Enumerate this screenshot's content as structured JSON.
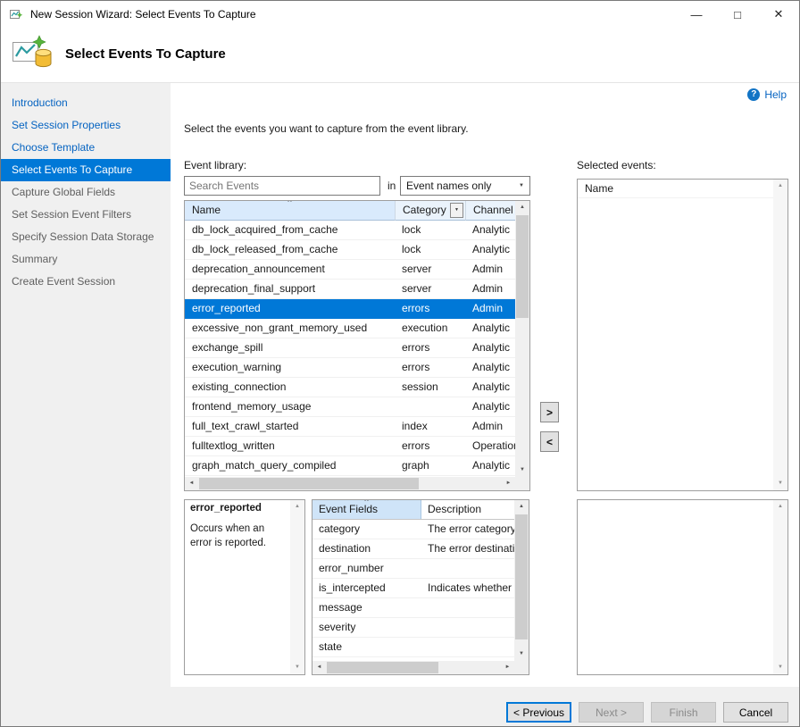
{
  "window": {
    "title": "New Session Wizard: Select Events To Capture"
  },
  "header": {
    "title": "Select Events To Capture"
  },
  "help": {
    "label": "Help"
  },
  "sidebar": {
    "items": [
      {
        "label": "Introduction",
        "state": "link"
      },
      {
        "label": "Set Session Properties",
        "state": "link"
      },
      {
        "label": "Choose Template",
        "state": "link"
      },
      {
        "label": "Select Events To Capture",
        "state": "active"
      },
      {
        "label": "Capture Global Fields",
        "state": "normal"
      },
      {
        "label": "Set Session Event Filters",
        "state": "normal"
      },
      {
        "label": "Specify Session Data Storage",
        "state": "normal"
      },
      {
        "label": "Summary",
        "state": "normal"
      },
      {
        "label": "Create Event Session",
        "state": "normal"
      }
    ]
  },
  "main": {
    "instruction": "Select the events you want to capture from the event library.",
    "event_library_label": "Event library:",
    "search": {
      "placeholder": "Search Events"
    },
    "in_label": "in",
    "scope_dropdown": {
      "value": "Event names only"
    },
    "events_table": {
      "columns": [
        "Name",
        "Category",
        "Channel"
      ],
      "selected_index": 4,
      "rows": [
        {
          "name": "db_lock_acquired_from_cache",
          "category": "lock",
          "channel": "Analytic"
        },
        {
          "name": "db_lock_released_from_cache",
          "category": "lock",
          "channel": "Analytic"
        },
        {
          "name": "deprecation_announcement",
          "category": "server",
          "channel": "Admin"
        },
        {
          "name": "deprecation_final_support",
          "category": "server",
          "channel": "Admin"
        },
        {
          "name": "error_reported",
          "category": "errors",
          "channel": "Admin"
        },
        {
          "name": "excessive_non_grant_memory_used",
          "category": "execution",
          "channel": "Analytic"
        },
        {
          "name": "exchange_spill",
          "category": "errors",
          "channel": "Analytic"
        },
        {
          "name": "execution_warning",
          "category": "errors",
          "channel": "Analytic"
        },
        {
          "name": "existing_connection",
          "category": "session",
          "channel": "Analytic"
        },
        {
          "name": "frontend_memory_usage",
          "category": "",
          "channel": "Analytic"
        },
        {
          "name": "full_text_crawl_started",
          "category": "index",
          "channel": "Admin"
        },
        {
          "name": "fulltextlog_written",
          "category": "errors",
          "channel": "Operational"
        },
        {
          "name": "graph_match_query_compiled",
          "category": "graph",
          "channel": "Analytic"
        }
      ]
    },
    "selected_events": {
      "label": "Selected events:",
      "column_header": "Name"
    },
    "move_right": ">",
    "move_left": "<",
    "detail": {
      "title": "error_reported",
      "description": "Occurs when an error is reported."
    },
    "fields_table": {
      "columns": [
        "Event Fields",
        "Description"
      ],
      "rows": [
        [
          "category",
          "The error category."
        ],
        [
          "destination",
          "The error destination"
        ],
        [
          "error_number",
          ""
        ],
        [
          "is_intercepted",
          "Indicates whether th"
        ],
        [
          "message",
          ""
        ],
        [
          "severity",
          ""
        ],
        [
          "state",
          ""
        ]
      ]
    }
  },
  "footer": {
    "previous": "< Previous",
    "next": "Next >",
    "finish": "Finish",
    "cancel": "Cancel"
  },
  "colors": {
    "accent": "#0078d7",
    "selection": "#0078d7",
    "link": "#0563c1"
  },
  "icons": {
    "minimize": "—",
    "maximize": "□",
    "close": "✕",
    "help": "?",
    "dropdown": "▼",
    "sort_asc": "^",
    "up": "▲",
    "down": "▼",
    "left": "◄",
    "right": "►"
  }
}
